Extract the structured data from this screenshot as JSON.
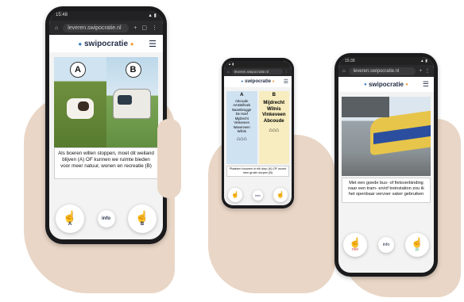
{
  "app": {
    "brand": "swipocratie",
    "url": "leveren.swipocratie.nl"
  },
  "phone1": {
    "time": "15:48",
    "option_a": "A",
    "option_b": "B",
    "caption": "Als boeren willen stoppen, moet dit weiland blijven (A) OF kunnen we ruimte bieden voor meer natuur, wonen en recreatie (B)",
    "left_label": "A",
    "center_label": "info",
    "right_label": "B"
  },
  "phone2": {
    "col_a": {
      "header": "A",
      "items": [
        "Abcoude",
        "Amstelhoek",
        "Baambrugge",
        "De Hoef",
        "Mijdrecht",
        "Vinkeveen",
        "Waverveen",
        "Wilnis"
      ]
    },
    "col_b": {
      "header": "B",
      "items": [
        "Mijdrecht",
        "Wilnis",
        "Vinkeveen",
        "Abcoude"
      ]
    },
    "caption": "Plaatsen bouwen in elk dorp (A) OF woont men groter dorpen (B)",
    "center_label": "info"
  },
  "phone3": {
    "time": "15:39",
    "caption": "Met een goede bus- of fietsverbinding naar een tram- en/of treinstation zou ik het openbaar vervoer vaker gebruiken",
    "left_label": "nee",
    "center_label": "info",
    "right_label": "ja"
  }
}
